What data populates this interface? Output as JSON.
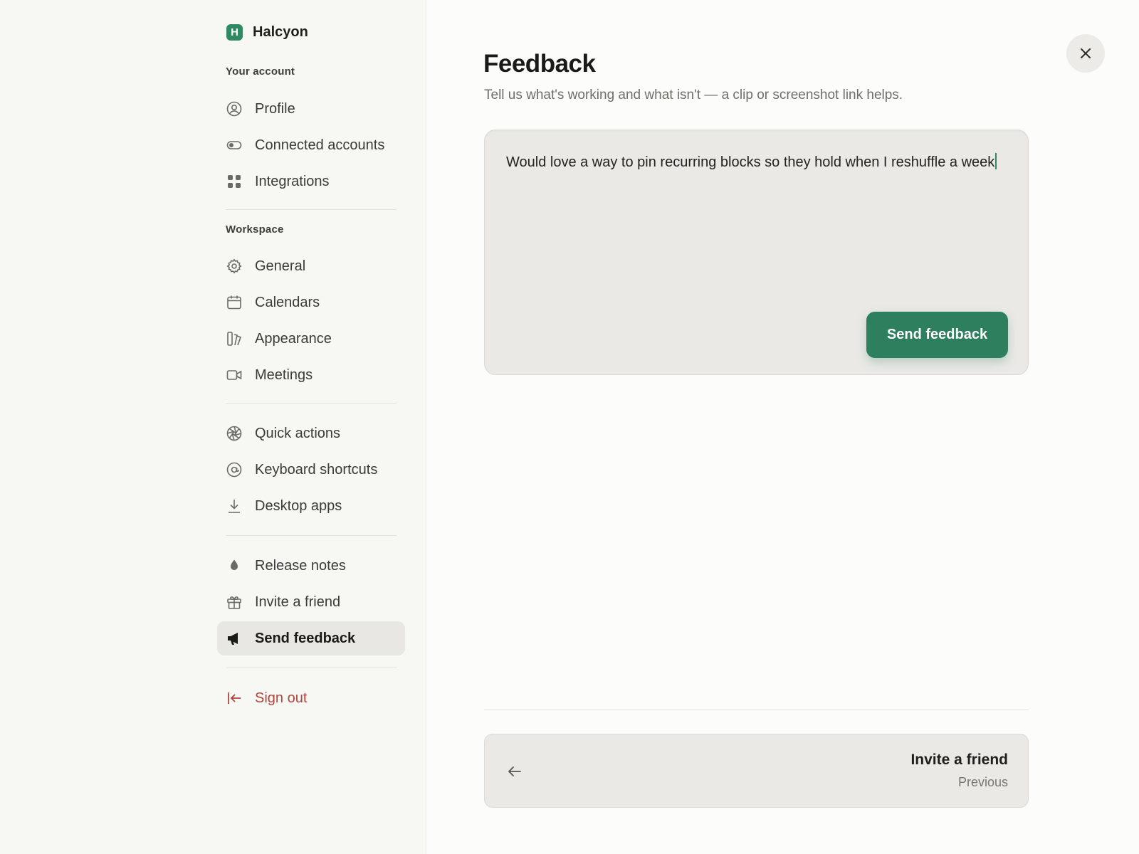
{
  "brand": {
    "name": "Halcyon",
    "logo_letter": "H"
  },
  "sidebar": {
    "sections": {
      "account_label": "Your account",
      "workspace_label": "Workspace"
    },
    "account_items": [
      {
        "label": "Profile",
        "icon": "person-circle-icon"
      },
      {
        "label": "Connected accounts",
        "icon": "toggle-icon"
      },
      {
        "label": "Integrations",
        "icon": "grid-dots-icon"
      }
    ],
    "workspace_items": [
      {
        "label": "General",
        "icon": "gear-icon"
      },
      {
        "label": "Calendars",
        "icon": "calendar-icon"
      },
      {
        "label": "Appearance",
        "icon": "appearance-icon"
      },
      {
        "label": "Meetings",
        "icon": "video-icon"
      }
    ],
    "tool_items": [
      {
        "label": "Quick actions",
        "icon": "aperture-icon"
      },
      {
        "label": "Keyboard shortcuts",
        "icon": "at-sign-icon"
      },
      {
        "label": "Desktop apps",
        "icon": "download-icon"
      }
    ],
    "misc_items": [
      {
        "label": "Release notes",
        "icon": "droplet-icon"
      },
      {
        "label": "Invite a friend",
        "icon": "gift-icon"
      },
      {
        "label": "Send feedback",
        "icon": "megaphone-icon",
        "active": true
      }
    ],
    "sign_out": {
      "label": "Sign out",
      "icon": "sign-out-icon"
    }
  },
  "main": {
    "title": "Feedback",
    "subtitle": "Tell us what's working and what isn't — a clip or screenshot link helps.",
    "feedback": {
      "value": "Would love a way to pin recurring blocks so they hold when I reshuffle a week",
      "submit_label": "Send feedback"
    },
    "previous": {
      "title": "Invite a friend",
      "caption": "Previous"
    }
  },
  "colors": {
    "accent": "#2d7f5d",
    "danger": "#b0463c",
    "sidebar_bg": "#f7f7f4",
    "active_bg": "#e8e7e3"
  }
}
